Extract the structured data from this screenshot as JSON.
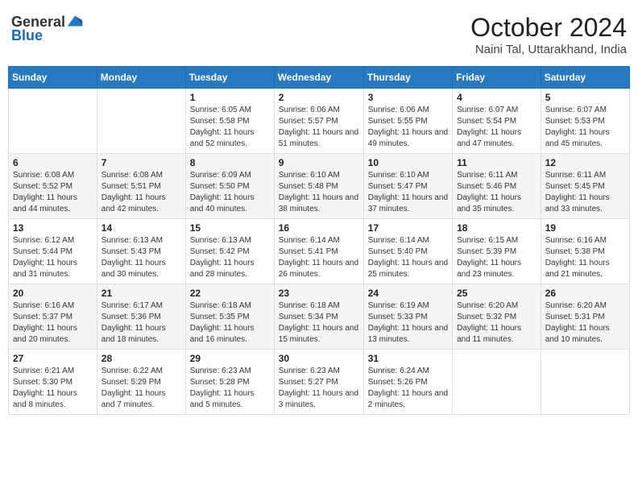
{
  "logo": {
    "general": "General",
    "blue": "Blue"
  },
  "title": {
    "month": "October 2024",
    "location": "Naini Tal, Uttarakhand, India"
  },
  "headers": [
    "Sunday",
    "Monday",
    "Tuesday",
    "Wednesday",
    "Thursday",
    "Friday",
    "Saturday"
  ],
  "weeks": [
    [
      {
        "day": "",
        "content": ""
      },
      {
        "day": "",
        "content": ""
      },
      {
        "day": "1",
        "content": "Sunrise: 6:05 AM\nSunset: 5:58 PM\nDaylight: 11 hours and 52 minutes."
      },
      {
        "day": "2",
        "content": "Sunrise: 6:06 AM\nSunset: 5:57 PM\nDaylight: 11 hours and 51 minutes."
      },
      {
        "day": "3",
        "content": "Sunrise: 6:06 AM\nSunset: 5:55 PM\nDaylight: 11 hours and 49 minutes."
      },
      {
        "day": "4",
        "content": "Sunrise: 6:07 AM\nSunset: 5:54 PM\nDaylight: 11 hours and 47 minutes."
      },
      {
        "day": "5",
        "content": "Sunrise: 6:07 AM\nSunset: 5:53 PM\nDaylight: 11 hours and 45 minutes."
      }
    ],
    [
      {
        "day": "6",
        "content": "Sunrise: 6:08 AM\nSunset: 5:52 PM\nDaylight: 11 hours and 44 minutes."
      },
      {
        "day": "7",
        "content": "Sunrise: 6:08 AM\nSunset: 5:51 PM\nDaylight: 11 hours and 42 minutes."
      },
      {
        "day": "8",
        "content": "Sunrise: 6:09 AM\nSunset: 5:50 PM\nDaylight: 11 hours and 40 minutes."
      },
      {
        "day": "9",
        "content": "Sunrise: 6:10 AM\nSunset: 5:48 PM\nDaylight: 11 hours and 38 minutes."
      },
      {
        "day": "10",
        "content": "Sunrise: 6:10 AM\nSunset: 5:47 PM\nDaylight: 11 hours and 37 minutes."
      },
      {
        "day": "11",
        "content": "Sunrise: 6:11 AM\nSunset: 5:46 PM\nDaylight: 11 hours and 35 minutes."
      },
      {
        "day": "12",
        "content": "Sunrise: 6:11 AM\nSunset: 5:45 PM\nDaylight: 11 hours and 33 minutes."
      }
    ],
    [
      {
        "day": "13",
        "content": "Sunrise: 6:12 AM\nSunset: 5:44 PM\nDaylight: 11 hours and 31 minutes."
      },
      {
        "day": "14",
        "content": "Sunrise: 6:13 AM\nSunset: 5:43 PM\nDaylight: 11 hours and 30 minutes."
      },
      {
        "day": "15",
        "content": "Sunrise: 6:13 AM\nSunset: 5:42 PM\nDaylight: 11 hours and 28 minutes."
      },
      {
        "day": "16",
        "content": "Sunrise: 6:14 AM\nSunset: 5:41 PM\nDaylight: 11 hours and 26 minutes."
      },
      {
        "day": "17",
        "content": "Sunrise: 6:14 AM\nSunset: 5:40 PM\nDaylight: 11 hours and 25 minutes."
      },
      {
        "day": "18",
        "content": "Sunrise: 6:15 AM\nSunset: 5:39 PM\nDaylight: 11 hours and 23 minutes."
      },
      {
        "day": "19",
        "content": "Sunrise: 6:16 AM\nSunset: 5:38 PM\nDaylight: 11 hours and 21 minutes."
      }
    ],
    [
      {
        "day": "20",
        "content": "Sunrise: 6:16 AM\nSunset: 5:37 PM\nDaylight: 11 hours and 20 minutes."
      },
      {
        "day": "21",
        "content": "Sunrise: 6:17 AM\nSunset: 5:36 PM\nDaylight: 11 hours and 18 minutes."
      },
      {
        "day": "22",
        "content": "Sunrise: 6:18 AM\nSunset: 5:35 PM\nDaylight: 11 hours and 16 minutes."
      },
      {
        "day": "23",
        "content": "Sunrise: 6:18 AM\nSunset: 5:34 PM\nDaylight: 11 hours and 15 minutes."
      },
      {
        "day": "24",
        "content": "Sunrise: 6:19 AM\nSunset: 5:33 PM\nDaylight: 11 hours and 13 minutes."
      },
      {
        "day": "25",
        "content": "Sunrise: 6:20 AM\nSunset: 5:32 PM\nDaylight: 11 hours and 11 minutes."
      },
      {
        "day": "26",
        "content": "Sunrise: 6:20 AM\nSunset: 5:31 PM\nDaylight: 11 hours and 10 minutes."
      }
    ],
    [
      {
        "day": "27",
        "content": "Sunrise: 6:21 AM\nSunset: 5:30 PM\nDaylight: 11 hours and 8 minutes."
      },
      {
        "day": "28",
        "content": "Sunrise: 6:22 AM\nSunset: 5:29 PM\nDaylight: 11 hours and 7 minutes."
      },
      {
        "day": "29",
        "content": "Sunrise: 6:23 AM\nSunset: 5:28 PM\nDaylight: 11 hours and 5 minutes."
      },
      {
        "day": "30",
        "content": "Sunrise: 6:23 AM\nSunset: 5:27 PM\nDaylight: 11 hours and 3 minutes."
      },
      {
        "day": "31",
        "content": "Sunrise: 6:24 AM\nSunset: 5:26 PM\nDaylight: 11 hours and 2 minutes."
      },
      {
        "day": "",
        "content": ""
      },
      {
        "day": "",
        "content": ""
      }
    ]
  ]
}
